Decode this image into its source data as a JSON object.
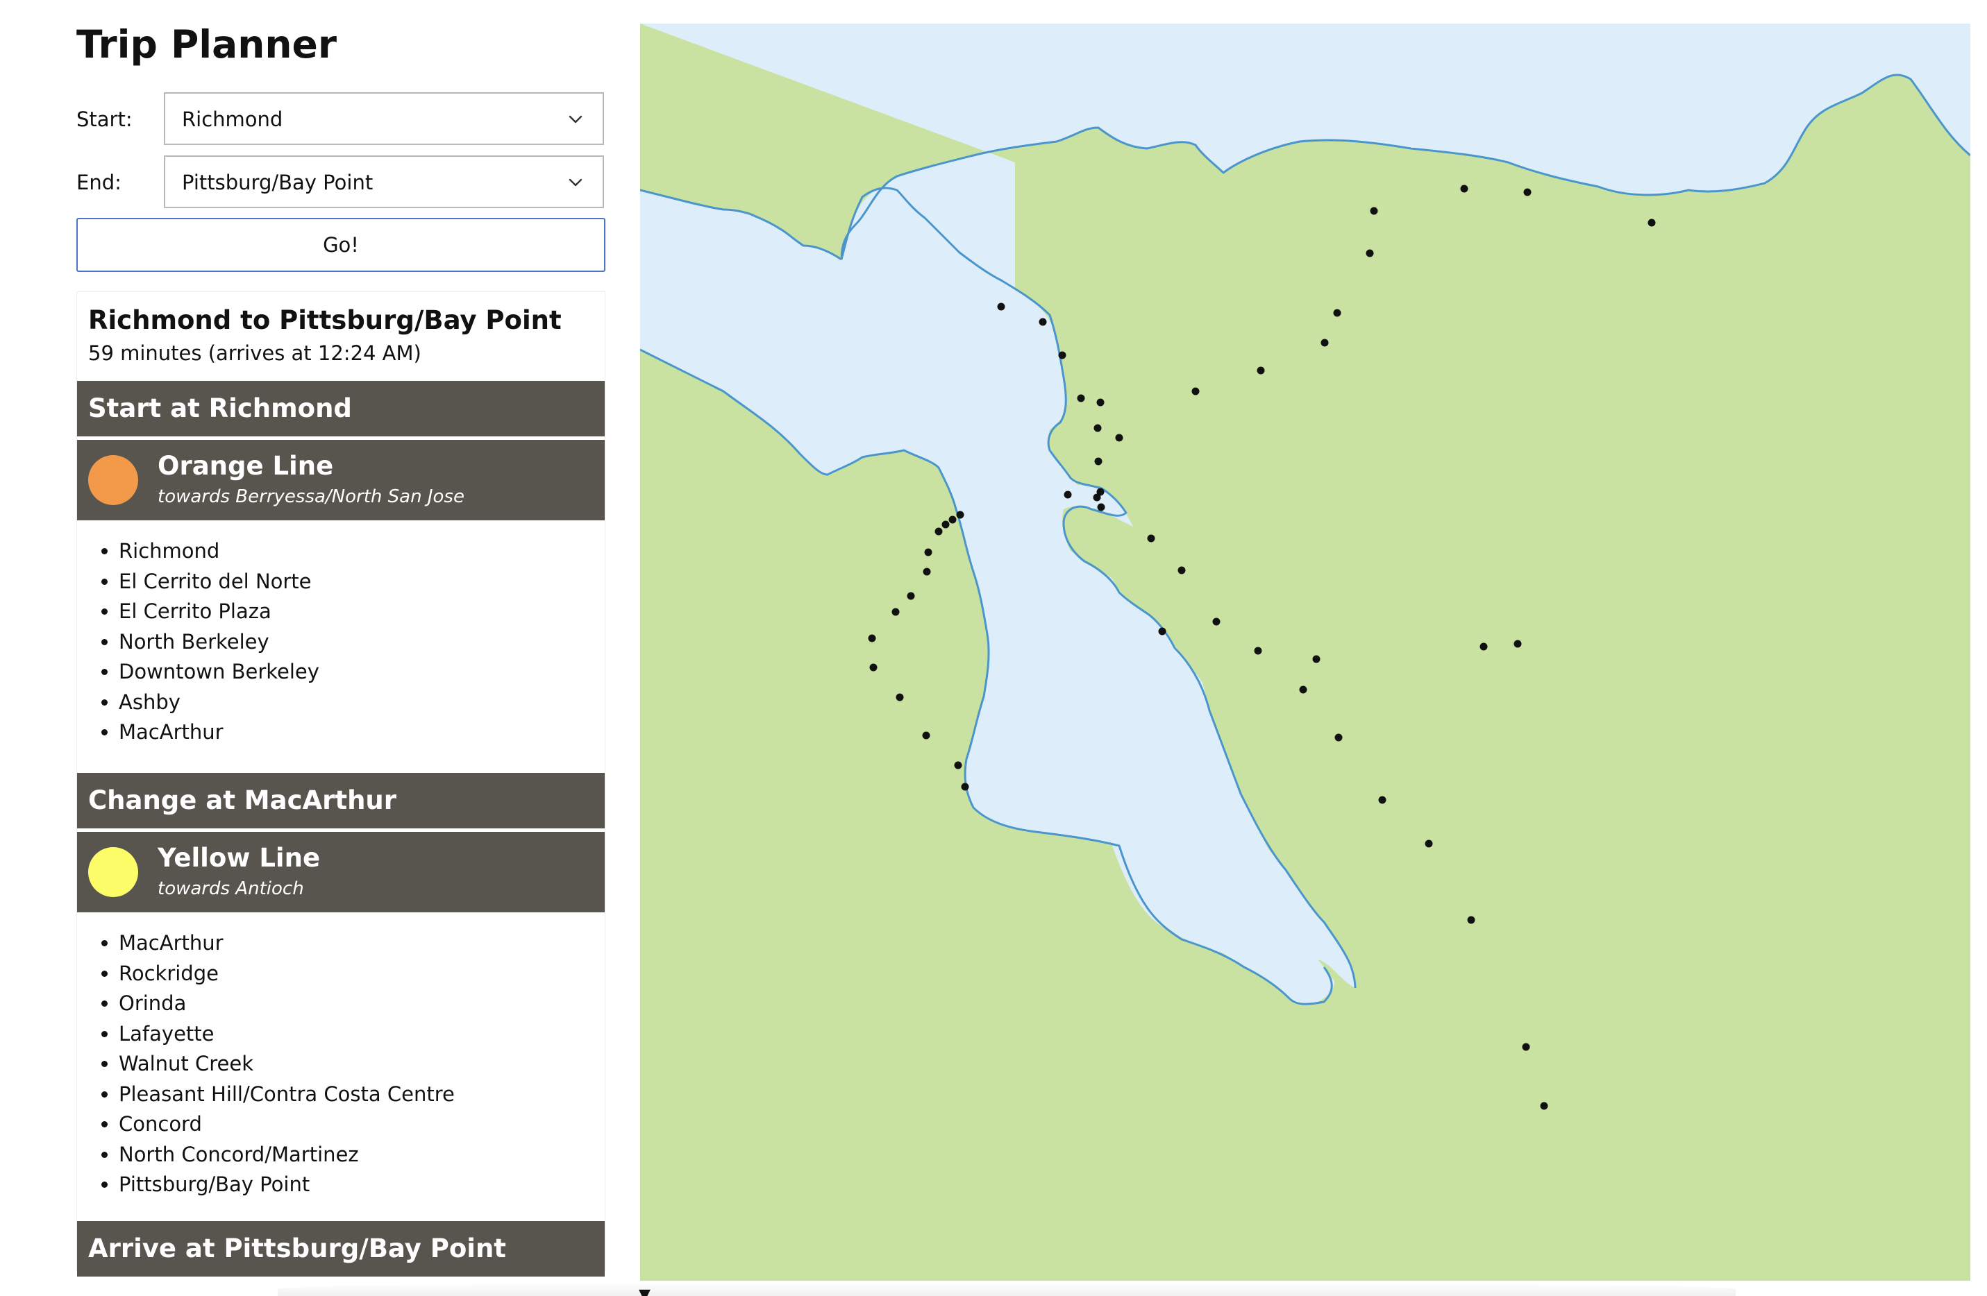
{
  "app": {
    "title": "Trip Planner"
  },
  "form": {
    "start_label": "Start:",
    "start_value": "Richmond",
    "end_label": "End:",
    "end_value": "Pittsburg/Bay Point",
    "go_label": "Go!"
  },
  "itinerary": {
    "title": "Richmond to Pittsburg/Bay Point",
    "summary": "59 minutes (arrives at 12:24 AM)",
    "start_step": "Start at Richmond",
    "legs": [
      {
        "line": "Orange Line",
        "towards": "towards Berryessa/North San Jose",
        "color": "#f39a4a",
        "stops": [
          "Richmond",
          "El Cerrito del Norte",
          "El Cerrito Plaza",
          "North Berkeley",
          "Downtown Berkeley",
          "Ashby",
          "MacArthur"
        ]
      },
      {
        "line": "Yellow Line",
        "towards": "towards Antioch",
        "color": "#fdfd6a",
        "stops": [
          "MacArthur",
          "Rockridge",
          "Orinda",
          "Lafayette",
          "Walnut Creek",
          "Pleasant Hill/Contra Costa Centre",
          "Concord",
          "North Concord/Martinez",
          "Pittsburg/Bay Point"
        ]
      }
    ],
    "change_step": "Change at MacArthur",
    "arrive_step": "Arrive at Pittsburg/Bay Point"
  },
  "map": {
    "land_color": "#c9e2a2",
    "water_color": "#ddeefa",
    "shore_color": "#4a95cc",
    "station_color": "#111111"
  },
  "scroll": {
    "marker_glyph": "▼"
  }
}
